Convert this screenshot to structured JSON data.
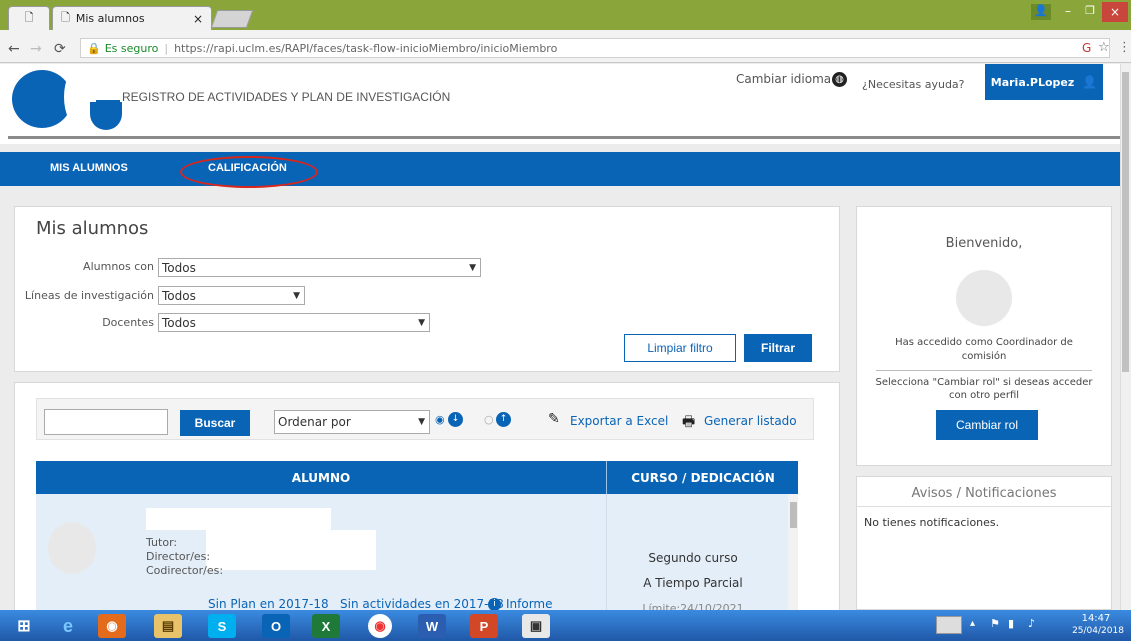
{
  "browser": {
    "tab_title": "Mis alumnos",
    "security_label": "Es seguro",
    "url": "https://rapi.uclm.es/RAPI/faces/task-flow-inicioMiembro/inicioMiembro"
  },
  "header": {
    "app_title": "REGISTRO DE ACTIVIDADES Y PLAN DE INVESTIGACIÓN",
    "change_language": "Cambiar idioma",
    "help": "¿Necesitas ayuda?",
    "user": "Maria.PLopez"
  },
  "nav": {
    "items": [
      {
        "label": "MIS ALUMNOS"
      },
      {
        "label": "CALIFICACIÓN"
      }
    ]
  },
  "filters": {
    "title": "Mis alumnos",
    "alumnos_con": {
      "label": "Alumnos con",
      "value": "Todos"
    },
    "lineas": {
      "label": "Líneas de investigación",
      "value": "Todos"
    },
    "docentes": {
      "label": "Docentes",
      "value": "Todos"
    },
    "clear_button": "Limpiar filtro",
    "filter_button": "Filtrar"
  },
  "toolbar": {
    "search_button": "Buscar",
    "sort_placeholder": "Ordenar por",
    "export_excel": "Exportar a Excel",
    "generate_list": "Generar listado"
  },
  "table": {
    "columns": [
      "ALUMNO",
      "CURSO / DEDICACIÓN"
    ],
    "rows": [
      {
        "tutor_label": "Tutor:",
        "director_label": "Director/es:",
        "codirector_label": "Codirector/es:",
        "course": "Segundo curso",
        "dedication": "A Tiempo Parcial",
        "limit": "Límite:24/10/2021",
        "links": [
          "Sin Plan en 2017-18",
          "Sin actividades en 2017-18",
          "Informe"
        ]
      }
    ]
  },
  "sidebar": {
    "welcome": "Bienvenido,",
    "role_text": "Has accedido como Coordinador de comisión",
    "change_role_hint": "Selecciona \"Cambiar rol\" si deseas acceder con otro perfil",
    "change_role_button": "Cambiar rol",
    "notifications_title": "Avisos / Notificaciones",
    "notifications_empty": "No tienes notificaciones."
  },
  "taskbar": {
    "time": "14:47",
    "date": "25/04/2018"
  },
  "colors": {
    "primary": "#0a64b6",
    "highlight_ring": "#d9261c"
  }
}
